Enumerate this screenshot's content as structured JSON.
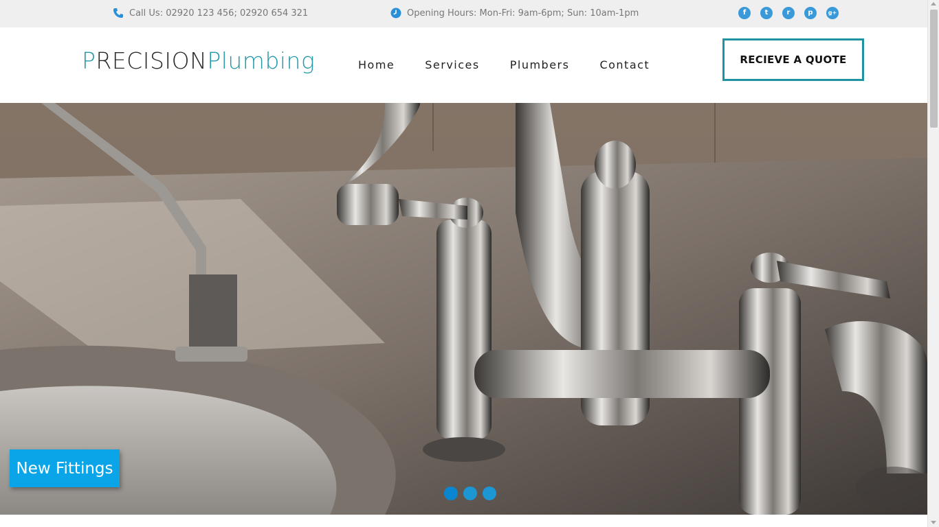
{
  "topbar": {
    "phone_text": "Call Us: 02920 123 456; 02920 654 321",
    "hours_text": "Opening Hours: Mon-Fri: 9am-6pm; Sun: 10am-1pm",
    "social": [
      {
        "icon": "facebook-icon",
        "glyph": "f"
      },
      {
        "icon": "twitter-icon",
        "glyph": "t"
      },
      {
        "icon": "rss-icon",
        "glyph": "r"
      },
      {
        "icon": "pinterest-icon",
        "glyph": "p"
      },
      {
        "icon": "google-plus-icon",
        "glyph": "g+"
      }
    ]
  },
  "header": {
    "logo_part1_first": "P",
    "logo_part1_rest": "RECISION",
    "logo_part2": "Plumbing",
    "nav": [
      "Home",
      "Services",
      "Plumbers",
      "Contact"
    ],
    "quote_button": "RECIEVE A QUOTE"
  },
  "hero": {
    "caption": "New Fittings",
    "slides": 3,
    "active_slide": 1
  },
  "colors": {
    "accent": "#1e93a1",
    "caption_bg": "#0aa5e9",
    "dot": "#1d97d4",
    "icon_blue": "#3a9ad9"
  }
}
